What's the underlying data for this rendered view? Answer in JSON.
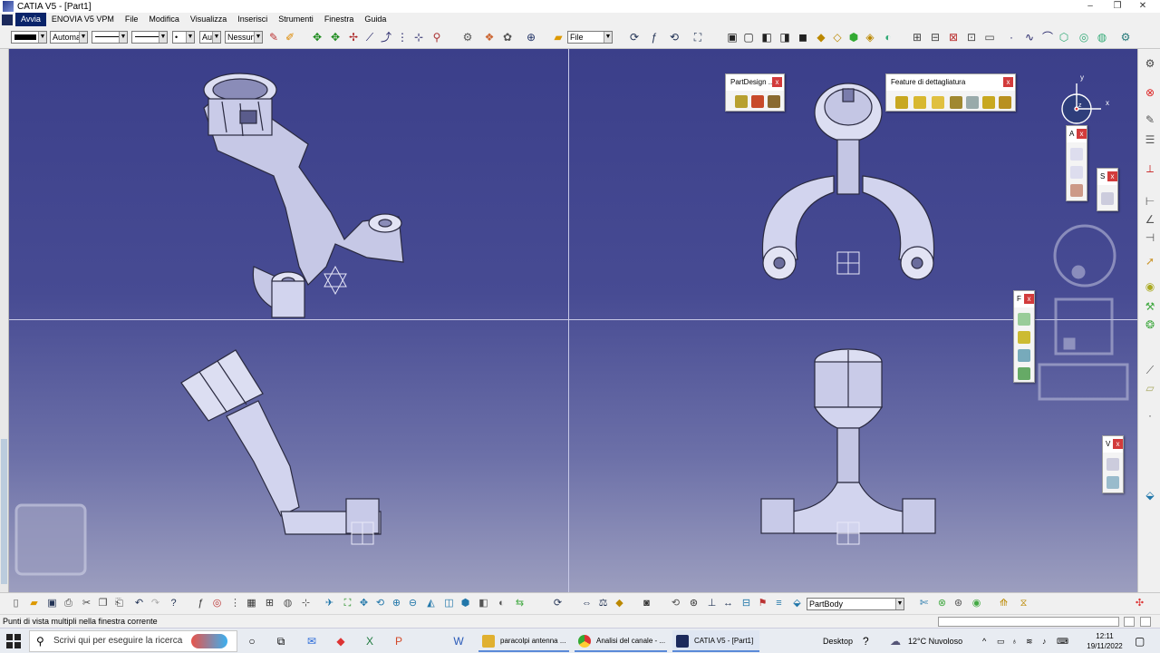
{
  "window": {
    "title": "CATIA V5 - [Part1]",
    "minimize": "–",
    "maximize": "❐",
    "close": "✕"
  },
  "menu": [
    "Avvia",
    "ENOVIA V5 VPM",
    "File",
    "Modifica",
    "Visualizza",
    "Inserisci",
    "Strumenti",
    "Finestra",
    "Guida"
  ],
  "toolbar": {
    "color_combo": "",
    "linetype_combo": "Automa",
    "weight_combo": "",
    "thickness_combo": "",
    "point_combo": "•",
    "layer_combo": "Aut",
    "filter_combo": "Nessun",
    "file_combo": "File"
  },
  "palettes": {
    "partdesign": {
      "title": "PartDesign ..."
    },
    "feature": {
      "title": "Feature di dettagliatura"
    },
    "small_a": {
      "title": "A"
    },
    "small_s": {
      "title": "S"
    },
    "small_f": {
      "title": "F"
    },
    "small_v": {
      "title": "V"
    },
    "close": "x"
  },
  "compass": {
    "x": "x",
    "y": "y",
    "z": "z"
  },
  "bottom_toolbar": {
    "body_combo": "PartBody"
  },
  "status": {
    "message": "Punti di vista multipli nella finestra corrente"
  },
  "taskbar": {
    "search_placeholder": "Scrivi qui per eseguire la ricerca",
    "tasks": [
      {
        "label": "paracolpi antenna ..."
      },
      {
        "label": "Analisi del canale - ..."
      },
      {
        "label": "CATIA V5 - [Part1]"
      }
    ],
    "desktop": "Desktop",
    "weather": "12°C Nuvoloso",
    "time": "12:11",
    "date": "19/11/2022"
  },
  "colors": {
    "viewport_top": "#3b3f8a",
    "viewport_bottom": "#9c9ebf",
    "part_fill": "#d2d4ee"
  }
}
